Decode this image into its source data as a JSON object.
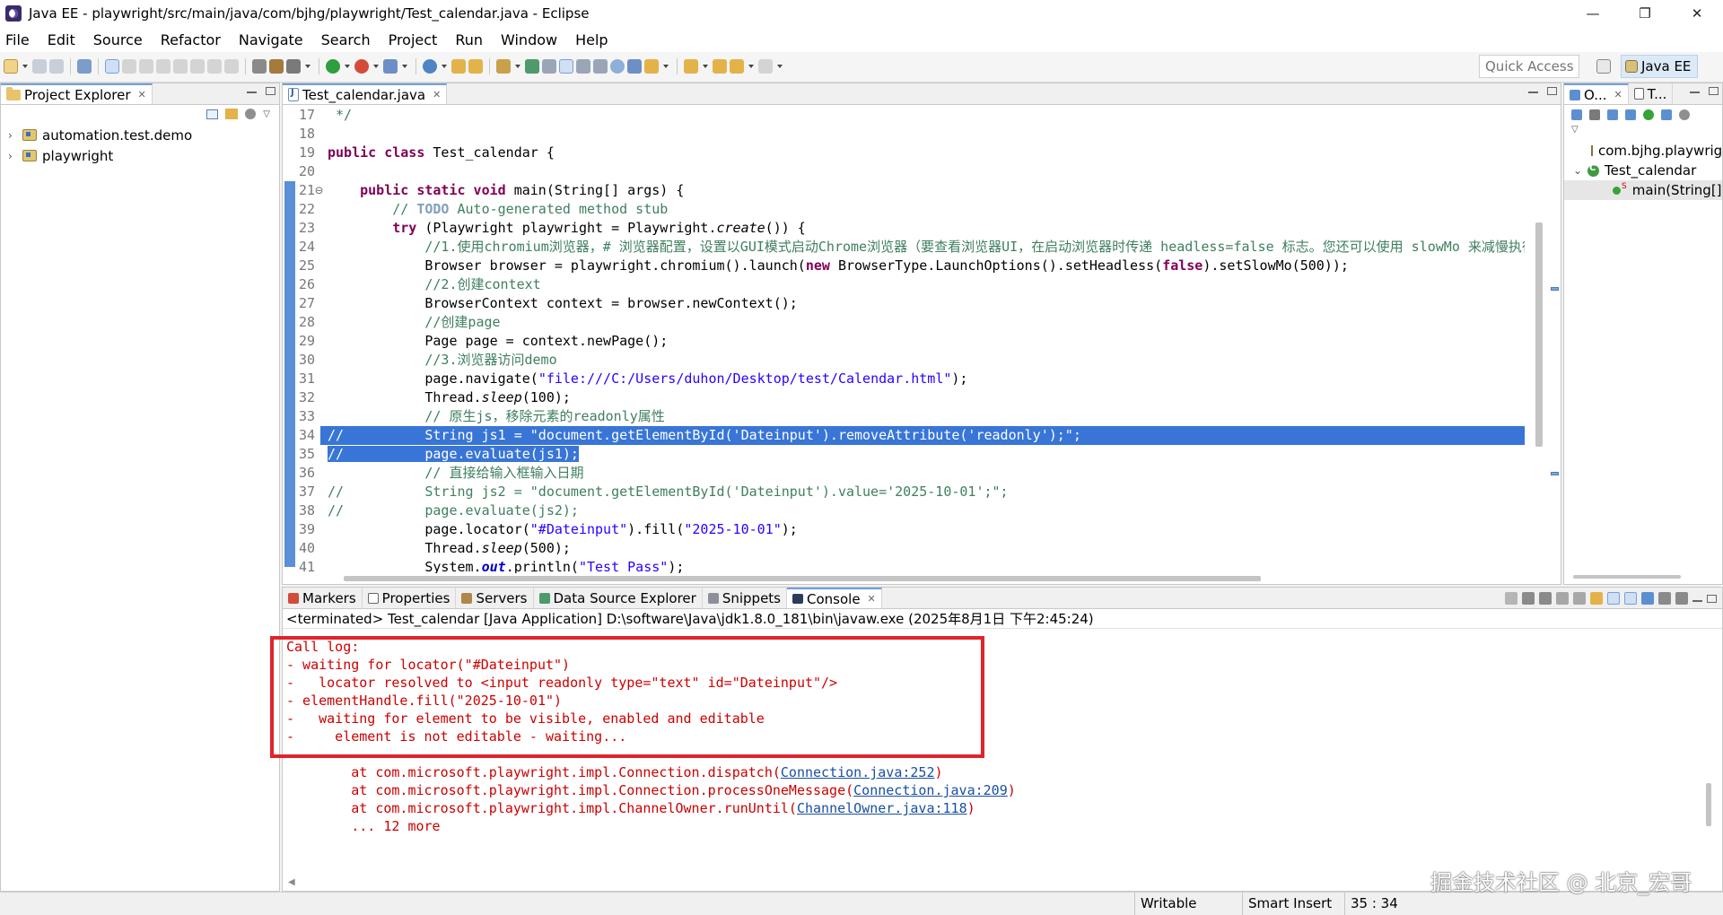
{
  "window": {
    "title": "Java EE - playwright/src/main/java/com/bjhg/playwright/Test_calendar.java - Eclipse",
    "minimize": "—",
    "restore": "❐",
    "close": "✕"
  },
  "menu": [
    "File",
    "Edit",
    "Source",
    "Refactor",
    "Navigate",
    "Search",
    "Project",
    "Run",
    "Window",
    "Help"
  ],
  "toolbar": {
    "quick_access_placeholder": "Quick Access",
    "perspective_label": "Java EE"
  },
  "project_explorer": {
    "tab_label": "Project Explorer",
    "items": [
      {
        "label": "automation.test.demo"
      },
      {
        "label": "playwright"
      }
    ]
  },
  "editor": {
    "tab_label": "Test_calendar.java"
  },
  "outline": {
    "tab1": "O...",
    "tab2": "T...",
    "items": [
      {
        "label": "com.bjhg.playwright",
        "type": "package"
      },
      {
        "label": "Test_calendar",
        "type": "class"
      },
      {
        "label": "main(String[]",
        "type": "method"
      }
    ]
  },
  "console": {
    "tabs": [
      "Markers",
      "Properties",
      "Servers",
      "Data Source Explorer",
      "Snippets",
      "Console"
    ],
    "status": "<terminated> Test_calendar [Java Application] D:\\software\\Java\\jdk1.8.0_181\\bin\\javaw.exe (2025年8月1日 下午2:45:24)",
    "lines": [
      "Call log:",
      "- waiting for locator(\"#Dateinput\")",
      "-   locator resolved to <input readonly type=\"text\" id=\"Dateinput\"/>",
      "- elementHandle.fill(\"2025-10-01\")",
      "-   waiting for element to be visible, enabled and editable",
      "-     element is not editable - waiting..."
    ],
    "stack": [
      {
        "prefix": "        at com.microsoft.playwright.impl.Connection.dispatch(",
        "link": "Connection.java:252",
        "suffix": ")"
      },
      {
        "prefix": "        at com.microsoft.playwright.impl.Connection.processOneMessage(",
        "link": "Connection.java:209",
        "suffix": ")"
      },
      {
        "prefix": "        at com.microsoft.playwright.impl.ChannelOwner.runUntil(",
        "link": "ChannelOwner.java:118",
        "suffix": ")"
      }
    ],
    "more": "        ... 12 more"
  },
  "statusbar": {
    "writable": "Writable",
    "insert_mode": "Smart Insert",
    "position": "35 : 34"
  },
  "watermark": "掘金技术社区 @ 北京_宏哥"
}
